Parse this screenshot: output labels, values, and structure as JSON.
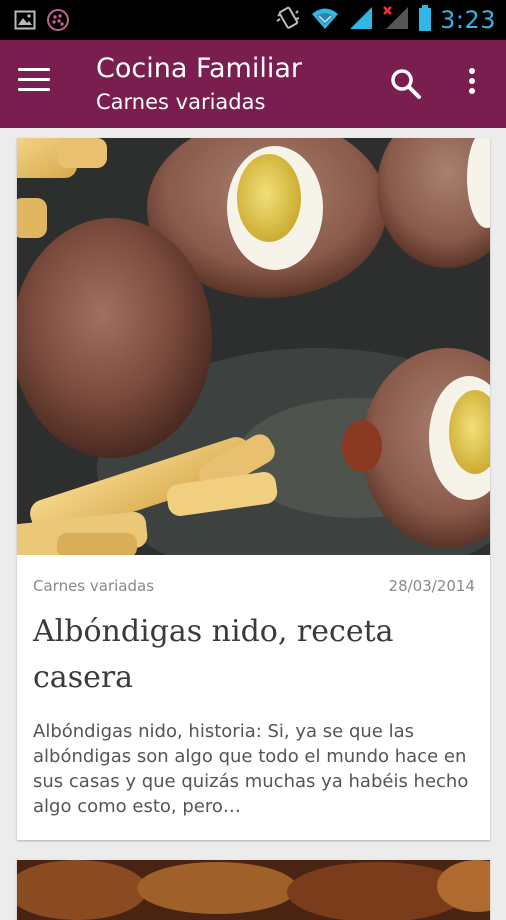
{
  "status_bar": {
    "time": "3:23",
    "icons": [
      "image-icon",
      "bbm-icon",
      "vibrate-icon",
      "wifi-icon",
      "signal-icon",
      "no-signal-icon",
      "battery-icon"
    ],
    "accent_color": "#33b5e5"
  },
  "app_bar": {
    "title": "Cocina Familiar",
    "subtitle": "Carnes variadas",
    "color": "#7a1d4f",
    "menu_icon": "hamburger-menu-icon",
    "search_icon": "search-icon",
    "overflow_icon": "more-vert-icon"
  },
  "cards": [
    {
      "category": "Carnes variadas",
      "date": "28/03/2014",
      "title": "Albóndigas nido, receta casera",
      "excerpt": "Albóndigas nido, historia: Si, ya se que las albóndigas son algo que todo el mundo hace en sus casas y que quizás muchas ya habéis hecho algo como esto, pero…"
    }
  ]
}
